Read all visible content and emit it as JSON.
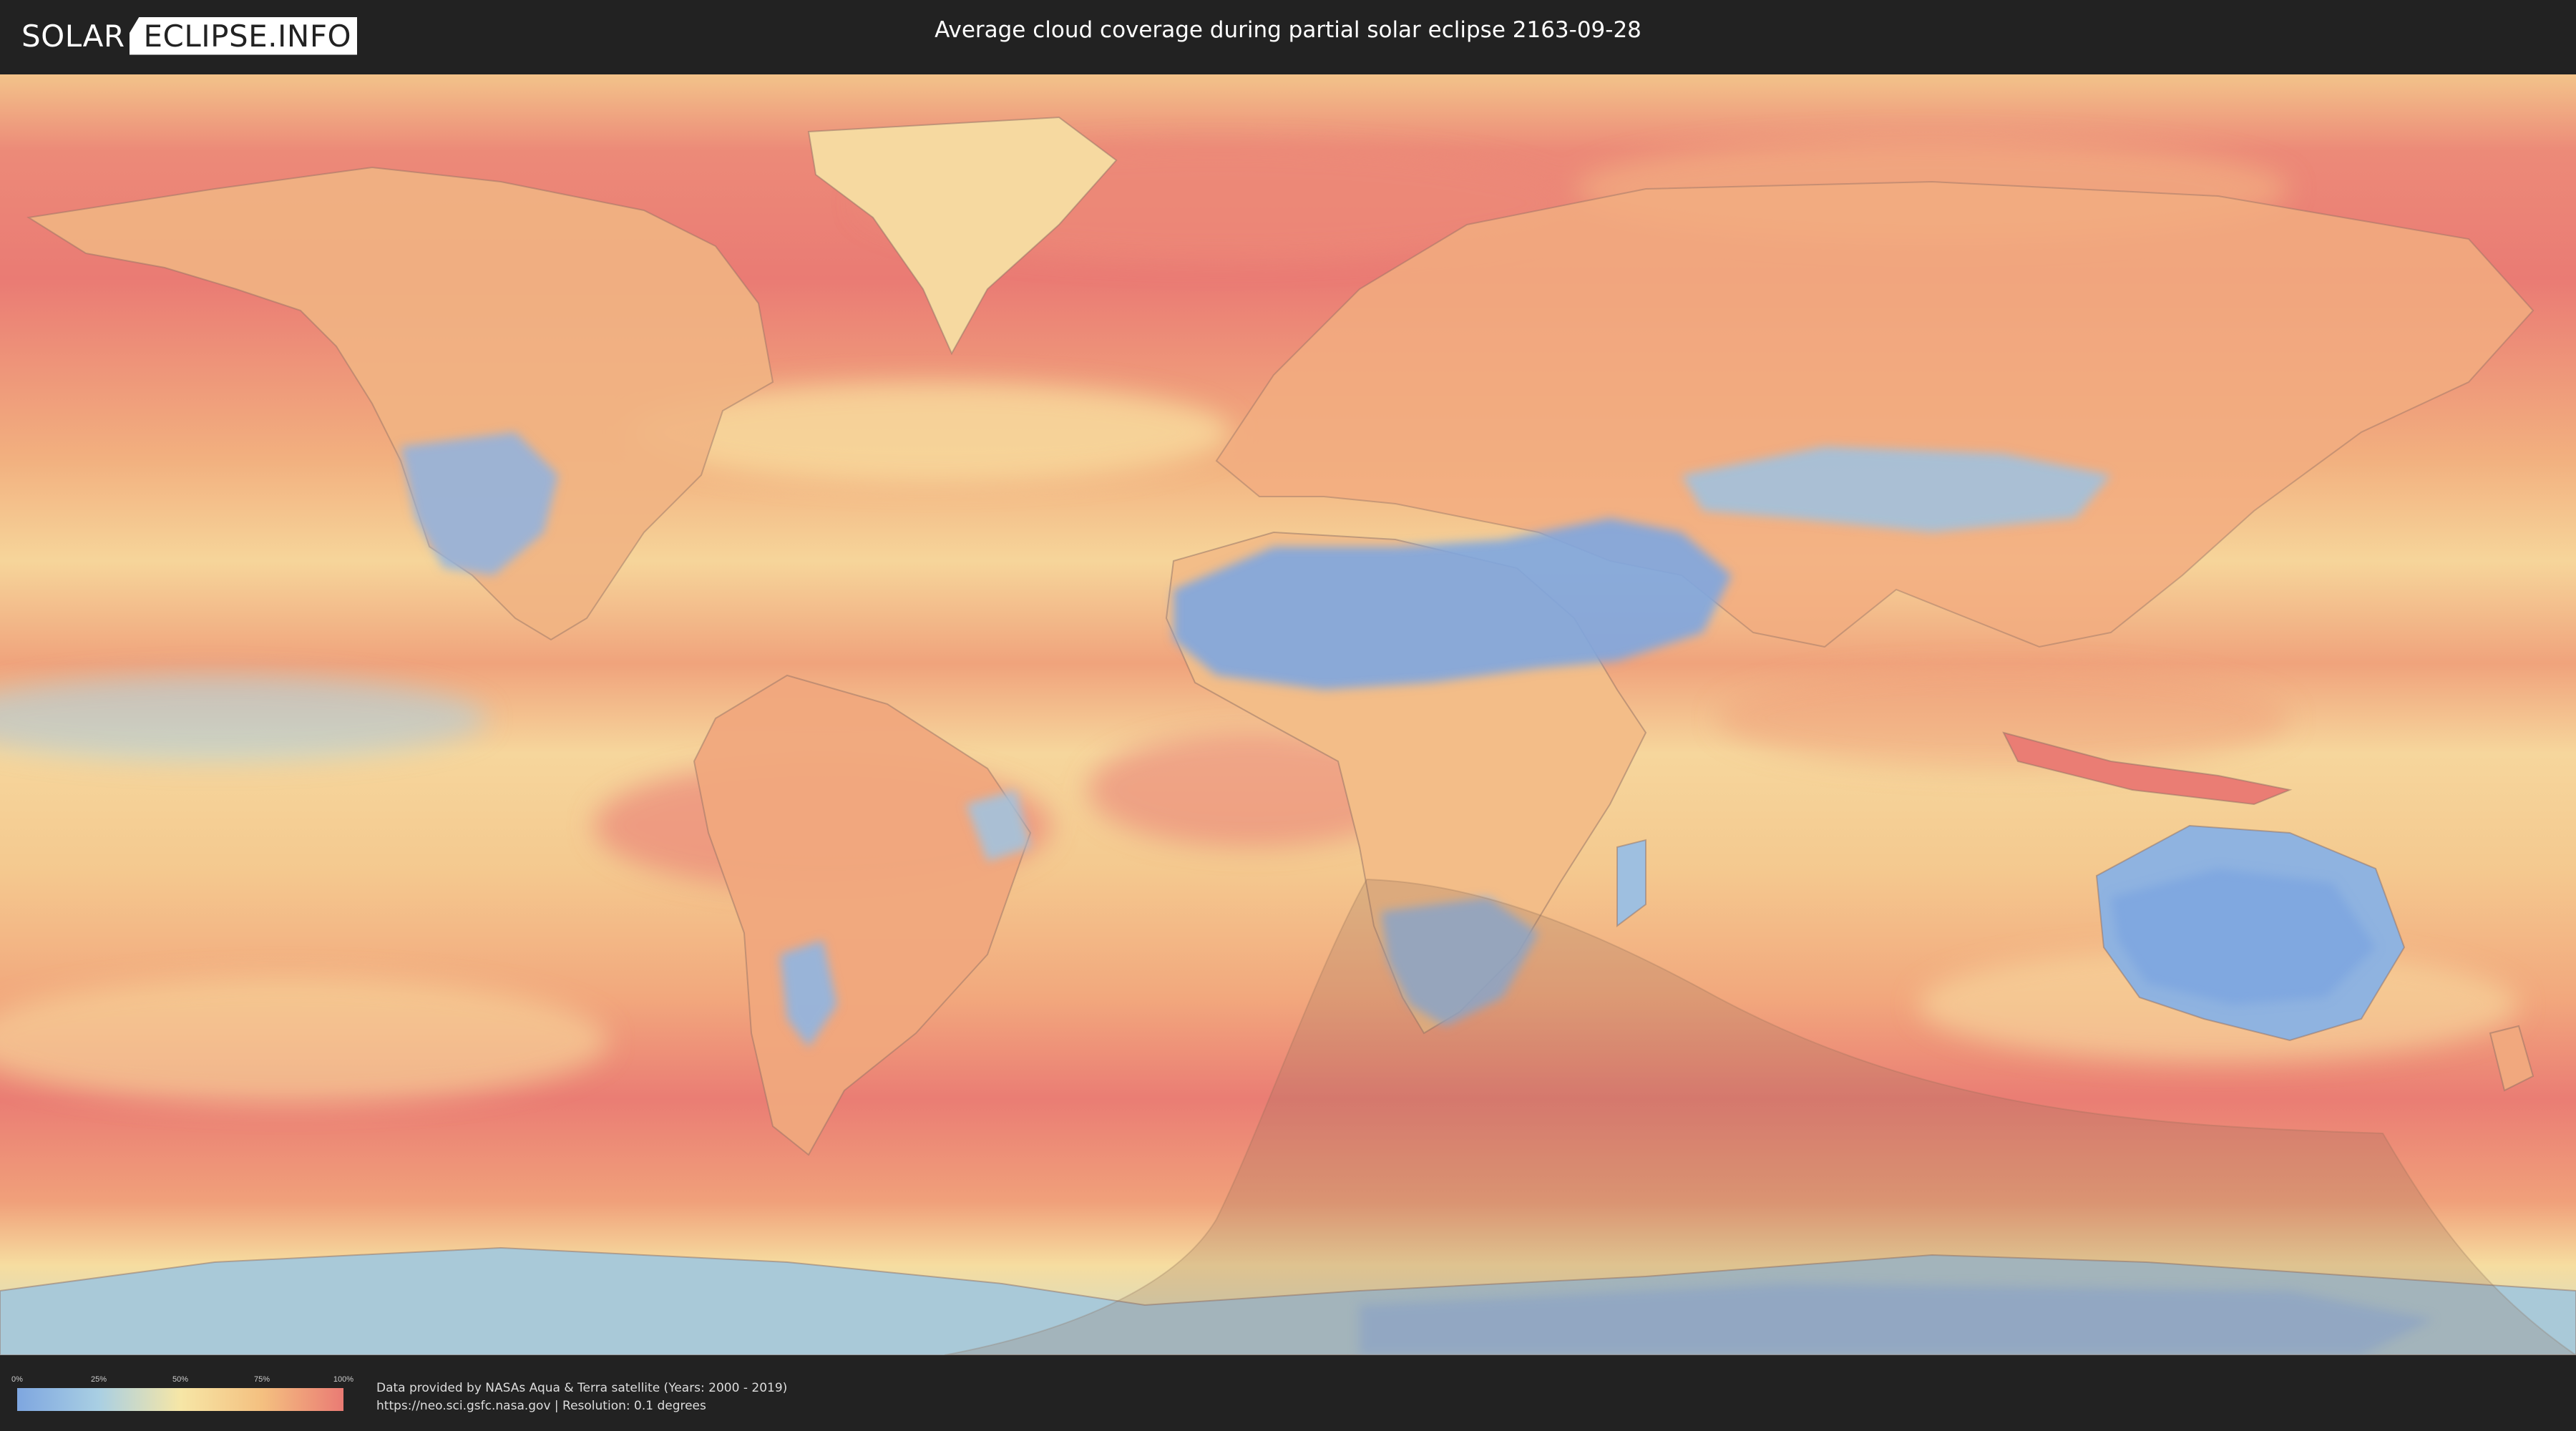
{
  "logo": {
    "left": "SOLAR",
    "right": "ECLIPSE.INFO"
  },
  "title": "Average cloud coverage during partial solar eclipse 2163-09-28",
  "scale": {
    "labels": [
      "0%",
      "25%",
      "50%",
      "75%",
      "100%"
    ],
    "colors": [
      "#7ea6e0",
      "#a9cfe3",
      "#f6e6a6",
      "#f4c080",
      "#ea7b74"
    ]
  },
  "credits": {
    "line1": "Data provided by NASAs Aqua & Terra satellite (Years: 2000 - 2019)",
    "line2": "https://neo.sci.gsfc.nasa.gov | Resolution: 0.1 degrees"
  },
  "palette": {
    "clear": "#7ea6e0",
    "light": "#a9cfe3",
    "mid": "#f6e6a6",
    "heavy": "#f4a270",
    "overcast": "#ea7b74",
    "eclipse_shadow": "#8c6a55"
  }
}
